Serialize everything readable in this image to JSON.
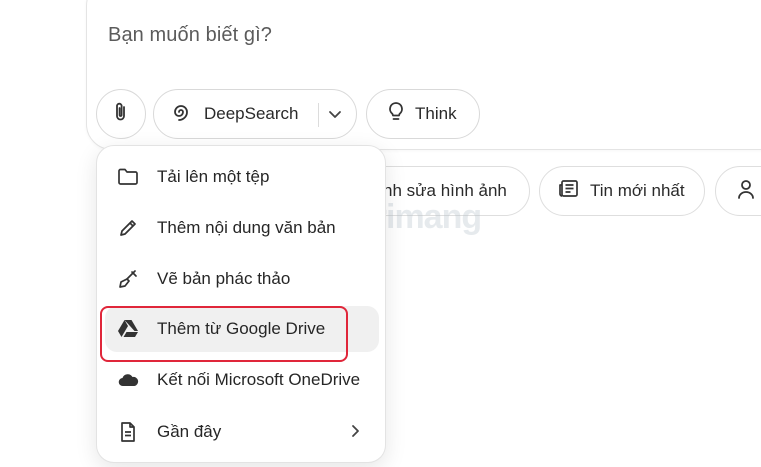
{
  "composer": {
    "placeholder": "Bạn muốn biết gì?"
  },
  "toolbar": {
    "attach_icon": "paperclip-icon",
    "deepsearch_label": "DeepSearch",
    "deepsearch_icon": "spiral-icon",
    "think_label": "Think",
    "think_icon": "lightbulb-icon"
  },
  "suggestions": {
    "edit_image_label": "nh sửa hình ảnh",
    "news_label": "Tin mới nhất",
    "news_icon": "newspaper-icon",
    "person_icon": "person-icon"
  },
  "menu": {
    "items": [
      {
        "label": "Tải lên một tệp",
        "icon": "folder-icon"
      },
      {
        "label": "Thêm nội dung văn bản",
        "icon": "pencil-icon"
      },
      {
        "label": "Vẽ bản phác thảo",
        "icon": "paintbrush-icon"
      },
      {
        "label": "Thêm từ Google Drive",
        "icon": "google-drive-icon"
      },
      {
        "label": "Kết nối Microsoft OneDrive",
        "icon": "onedrive-cloud-icon"
      },
      {
        "label": "Gần đây",
        "icon": "document-icon"
      }
    ]
  },
  "watermark": {
    "text": "uantrimang"
  },
  "colors": {
    "highlight_ring": "#e0263a",
    "menu_hover": "#f0f0f0",
    "border": "#e3e3e3"
  }
}
